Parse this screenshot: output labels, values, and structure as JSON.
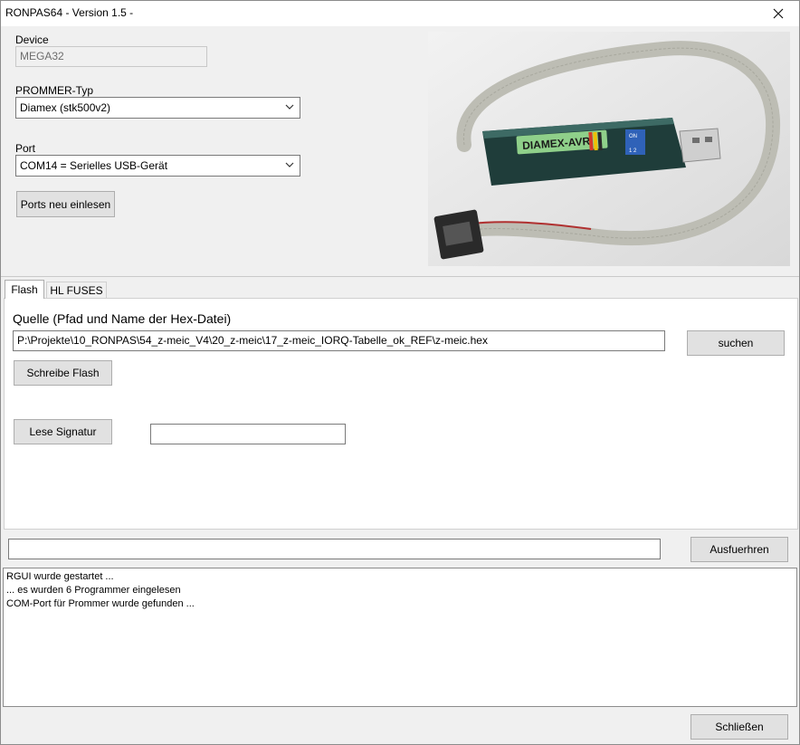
{
  "window": {
    "title": "RONPAS64 - Version 1.5 -"
  },
  "device": {
    "label": "Device",
    "value": "MEGA32"
  },
  "prommer": {
    "label": "PROMMER-Typ",
    "value": "Diamex (stk500v2)"
  },
  "port": {
    "label": "Port",
    "value": "COM14 = Serielles USB-Gerät",
    "reload_label": "Ports neu einlesen"
  },
  "photo": {
    "device_text": "DIAMEX-AVR",
    "switch_text": "ON",
    "switch_numbers": "1 2"
  },
  "tabs": [
    {
      "label": "Flash"
    },
    {
      "label": "HL FUSES"
    }
  ],
  "flash": {
    "source_label": "Quelle (Pfad und Name der Hex-Datei)",
    "path": "P:\\Projekte\\10_RONPAS\\54_z-meic_V4\\20_z-meic\\17_z-meic_IORQ-Tabelle_ok_REF\\z-meic.hex",
    "search_label": "suchen",
    "write_label": "Schreibe Flash",
    "read_sig_label": "Lese Signatur",
    "signature_value": ""
  },
  "command": {
    "value": "",
    "run_label": "Ausfuerhren"
  },
  "log": {
    "lines": [
      "RGUI wurde gestartet ...",
      "... es wurden 6 Programmer eingelesen",
      "COM-Port für Prommer wurde gefunden ..."
    ]
  },
  "footer": {
    "close_label": "Schließen"
  }
}
